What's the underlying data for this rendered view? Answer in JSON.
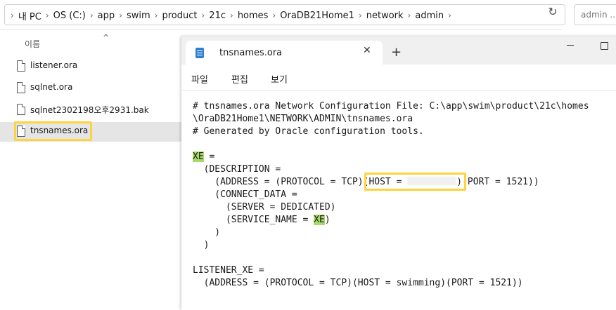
{
  "explorer": {
    "breadcrumbs": [
      "내 PC",
      "OS (C:)",
      "app",
      "swim",
      "product",
      "21c",
      "homes",
      "OraDB21Home1",
      "network",
      "admin"
    ],
    "search_placeholder": "admin ...",
    "column_name": "이름",
    "files": [
      "listener.ora",
      "sqlnet.ora",
      "sqlnet2302198오후2931.bak",
      "tnsnames.ora"
    ],
    "selected_file": "tnsnames.ora"
  },
  "notepad": {
    "tab_title": "tnsnames.ora",
    "menu": [
      "파일",
      "편집",
      "보기"
    ],
    "content": {
      "comment1a": "# tnsnames.ora Network Configuration File: C:\\app\\swim\\product\\21c\\homes",
      "comment1b": "\\OraDB21Home1\\NETWORK\\ADMIN\\tnsnames.ora",
      "comment2": "# Generated by Oracle configuration tools.",
      "xe_name": "XE",
      "eq": " =",
      "description": "  (DESCRIPTION =",
      "address_pre": "    (ADDRESS = (PROTOCOL = TCP)",
      "address_host": "(HOST = ",
      "address_post": ")(PORT = 1521))",
      "connect_data": "    (CONNECT_DATA =",
      "server": "      (SERVER = DEDICATED)",
      "service_pre": "      (SERVICE_NAME = ",
      "service_value": "XE",
      "service_post": ")",
      "close_inner": "    )",
      "close_outer": "  )",
      "listener": "LISTENER_XE =",
      "listener_address": "  (ADDRESS = (PROTOCOL = TCP)(HOST = swimming)(PORT = 1521))"
    }
  },
  "colors": {
    "annotation_yellow": "#ffd33d",
    "annotation_green": "#a9d96b",
    "selected_row": "#e5e5e5"
  }
}
